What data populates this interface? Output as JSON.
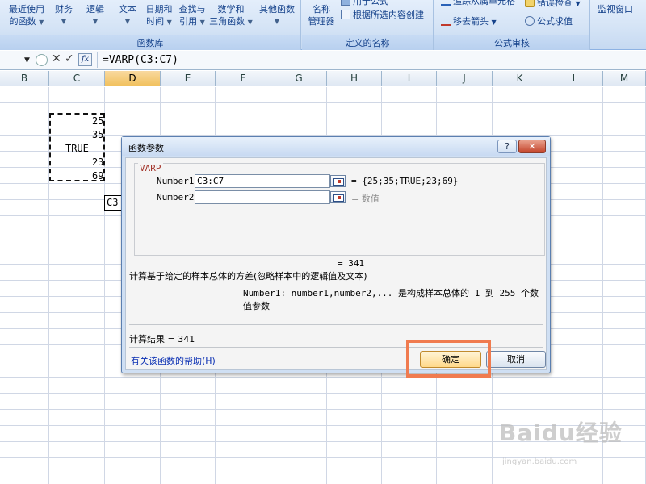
{
  "ribbon": {
    "groups": [
      {
        "title": "函数库"
      },
      {
        "title": "定义的名称"
      },
      {
        "title": "公式审核"
      }
    ],
    "buttons": {
      "recent": {
        "line1": "最近使用",
        "line2": "的函数"
      },
      "finance": {
        "line1": "财务"
      },
      "logic": {
        "line1": "逻辑"
      },
      "text": {
        "line1": "文本"
      },
      "datetime": {
        "line1": "日期和",
        "line2": "时间"
      },
      "lookup": {
        "line1": "查找与",
        "line2": "引用"
      },
      "math": {
        "line1": "数学和",
        "line2": "三角函数"
      },
      "other": {
        "line1": "其他函数"
      },
      "name_mgr": {
        "line1": "名称",
        "line2": "管理器"
      },
      "use_in_formula": "用于公式",
      "create_from_selection": "根据所选内容创建",
      "trace_dependents": "追踪从属单元格",
      "remove_arrows": "移去箭头",
      "error_check": "错误检查",
      "eval_formula": "公式求值",
      "watch_window": "监视窗口"
    }
  },
  "formula_bar": {
    "formula": "=VARP(C3:C7)"
  },
  "grid": {
    "columns": [
      "B",
      "C",
      "D",
      "E",
      "F",
      "G",
      "H",
      "I",
      "J",
      "K",
      "L",
      "M"
    ],
    "active_column": "D",
    "cells_c": [
      "25",
      "35",
      "TRUE",
      "23",
      "69"
    ],
    "tooltip": "C3"
  },
  "dialog": {
    "title": "函数参数",
    "help_btn": "?",
    "function_name": "VARP",
    "args": [
      {
        "label": "Number1",
        "value": "C3:C7",
        "result": "= {25;35;TRUE;23;69}"
      },
      {
        "label": "Number2",
        "value": "",
        "result": "= 数值"
      }
    ],
    "formula_result_inline": "= 341",
    "description": "计算基于给定的样本总体的方差(忽略样本中的逻辑值及文本)",
    "arg_help": "Number1:  number1,number2,... 是构成样本总体的 1 到 255 个数值参数",
    "result_label": "计算结果 = 341",
    "help_link": "有关该函数的帮助(H)",
    "ok_label": "确定",
    "cancel_label": "取消"
  },
  "watermark": {
    "brand": "Baidu经验",
    "url": "jingyan.baidu.com"
  }
}
